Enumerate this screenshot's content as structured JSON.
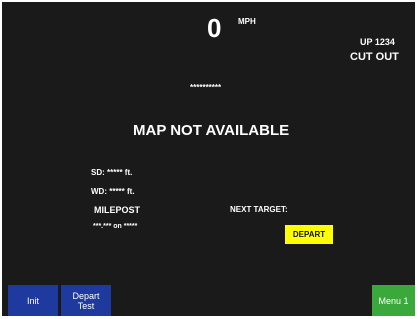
{
  "speed": {
    "value": "0",
    "unit": "MPH"
  },
  "train": {
    "id": "UP 1234",
    "status": "CUT OUT"
  },
  "masked_field": "**********",
  "map_message": "MAP NOT AVAILABLE",
  "info": {
    "sd": "SD:  ***** ft.",
    "wd": "WD:  ***** ft.",
    "milepost_label": "MILEPOST",
    "milepost_value": "***.*** on *****",
    "next_target_label": "NEXT TARGET:",
    "next_target_value": "DEPART"
  },
  "buttons": {
    "init": "Init",
    "depart_test_line1": "Depart",
    "depart_test_line2": "Test",
    "menu1": "Menu 1"
  },
  "colors": {
    "background": "#1a1a1a",
    "text": "#ffffff",
    "init_button": "#1f3a9e",
    "depart_test_button": "#1f3a9e",
    "menu_button": "#3aa83a",
    "target_badge": "#ffff00"
  }
}
